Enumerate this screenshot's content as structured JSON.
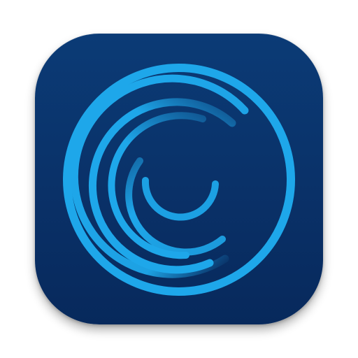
{
  "app_icon": {
    "icon_name": "spiral-rings-app-icon",
    "colors": {
      "tile_top": "#0b3b76",
      "tile_bottom": "#07295c",
      "ring": "#1ea7ea"
    }
  }
}
